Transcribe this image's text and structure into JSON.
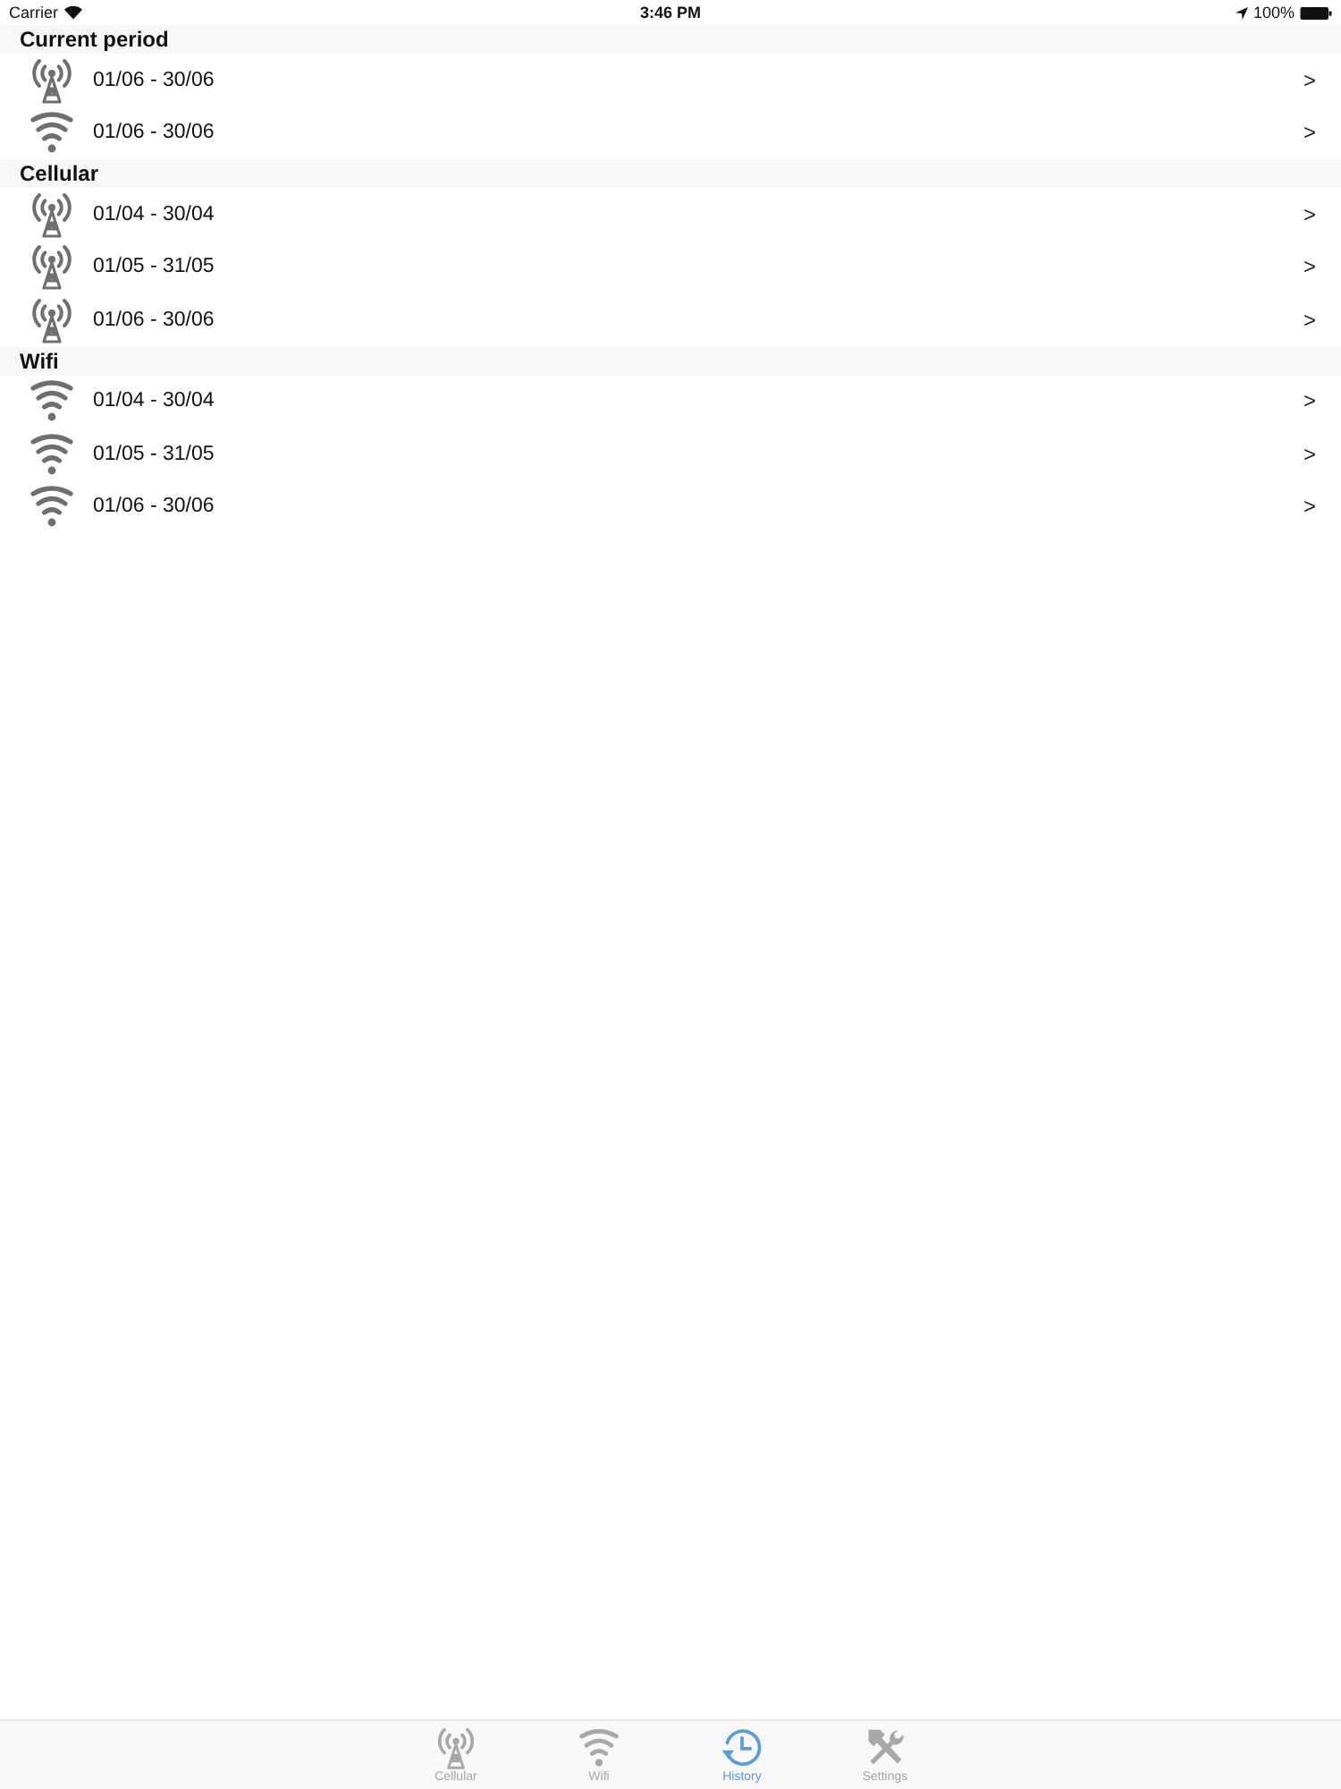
{
  "status_bar": {
    "carrier": "Carrier",
    "time": "3:46 PM",
    "battery": "100%"
  },
  "sections": [
    {
      "title": "Current period",
      "rows": [
        {
          "kind": "cellular",
          "label": "01/06 - 30/06",
          "chevron": ">"
        },
        {
          "kind": "wifi",
          "label": "01/06 - 30/06",
          "chevron": ">"
        }
      ]
    },
    {
      "title": "Cellular",
      "rows": [
        {
          "kind": "cellular",
          "label": "01/04 - 30/04",
          "chevron": ">"
        },
        {
          "kind": "cellular",
          "label": "01/05 - 31/05",
          "chevron": ">"
        },
        {
          "kind": "cellular",
          "label": "01/06 - 30/06",
          "chevron": ">"
        }
      ]
    },
    {
      "title": "Wifi",
      "rows": [
        {
          "kind": "wifi",
          "label": "01/04 - 30/04",
          "chevron": ">"
        },
        {
          "kind": "wifi",
          "label": "01/05 - 31/05",
          "chevron": ">"
        },
        {
          "kind": "wifi",
          "label": "01/06 - 30/06",
          "chevron": ">"
        }
      ]
    }
  ],
  "tab_bar": {
    "tabs": [
      {
        "kind": "cellular",
        "label": "Cellular",
        "selected": false
      },
      {
        "kind": "wifi",
        "label": "Wifi",
        "selected": false
      },
      {
        "kind": "history",
        "label": "History",
        "selected": true
      },
      {
        "kind": "settings",
        "label": "Settings",
        "selected": false
      }
    ]
  }
}
